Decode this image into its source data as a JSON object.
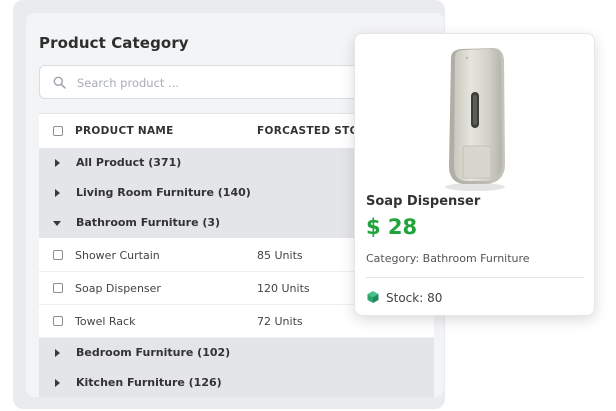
{
  "panel": {
    "title": "Product Category",
    "search_placeholder": "Search product ..."
  },
  "table": {
    "columns": [
      "PRODUCT NAME",
      "FORCASTED STOCK"
    ],
    "rows": [
      {
        "type": "group",
        "label": "All Product (371)",
        "expanded": false
      },
      {
        "type": "group",
        "label": "Living Room Furniture (140)",
        "expanded": false
      },
      {
        "type": "group",
        "label": "Bathroom Furniture (3)",
        "expanded": true
      },
      {
        "type": "item",
        "name": "Shower Curtain",
        "stock": "85 Units"
      },
      {
        "type": "item",
        "name": "Soap Dispenser",
        "stock": "120 Units"
      },
      {
        "type": "item",
        "name": "Towel Rack",
        "stock": "72 Units"
      },
      {
        "type": "group",
        "label": "Bedroom Furniture (102)",
        "expanded": false
      },
      {
        "type": "group",
        "label": "Kitchen Furniture (126)",
        "expanded": false
      }
    ]
  },
  "card": {
    "name": "Soap Dispenser",
    "price": "$ 28",
    "category": "Category: Bathroom Furniture",
    "stock": "Stock: 80",
    "price_color": "#1fa33a",
    "stock_icon": "box-icon"
  }
}
